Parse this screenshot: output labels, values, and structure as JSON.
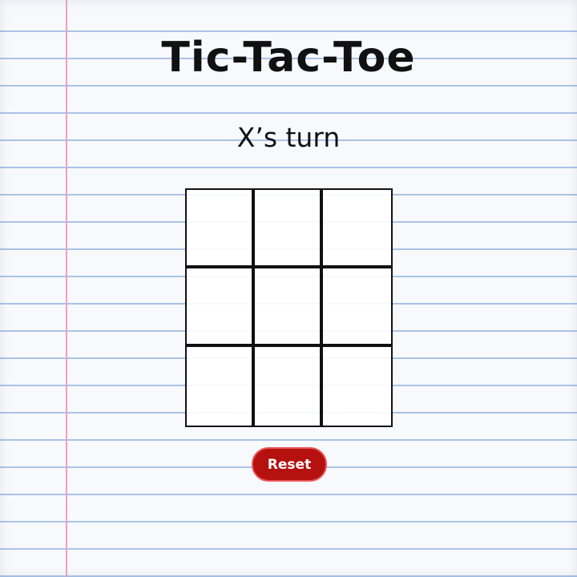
{
  "game": {
    "title": "Tic-Tac-Toe",
    "status": "X’s turn"
  },
  "board": {
    "cells": [
      "",
      "",
      "",
      "",
      "",
      "",
      "",
      "",
      ""
    ]
  },
  "controls": {
    "reset_label": "Reset"
  },
  "colors": {
    "paper": "#f8f9fc",
    "ruled_line": "#a9c3e6",
    "margin_line": "#f2a0c4",
    "grid_line": "#111111",
    "reset_button": "#b4110f",
    "reset_border": "#e8585a"
  }
}
